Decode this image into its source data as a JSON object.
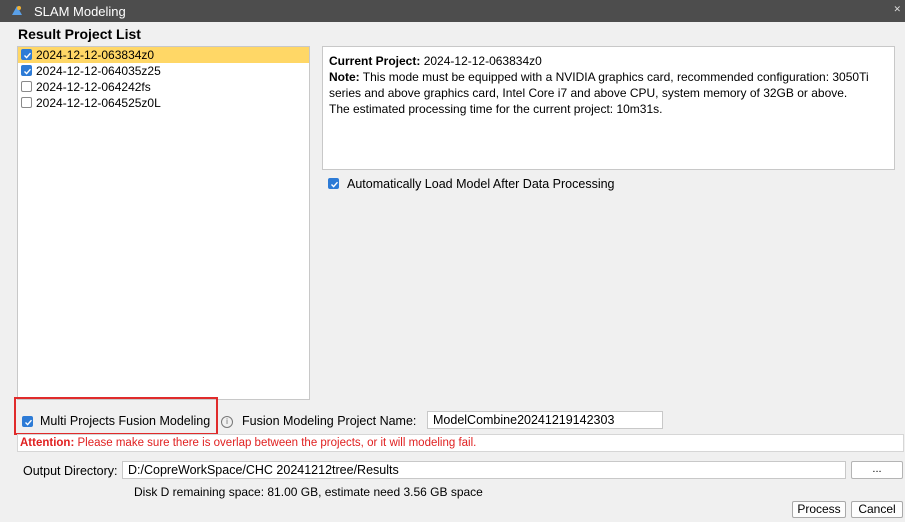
{
  "window": {
    "title": "SLAM Modeling"
  },
  "projects": {
    "heading": "Result Project List",
    "items": [
      {
        "label": "2024-12-12-063834z0",
        "checked": true,
        "selected": true
      },
      {
        "label": "2024-12-12-064035z25",
        "checked": true,
        "selected": false
      },
      {
        "label": "2024-12-12-064242fs",
        "checked": false,
        "selected": false
      },
      {
        "label": "2024-12-12-064525z0L",
        "checked": false,
        "selected": false
      }
    ]
  },
  "info": {
    "current_label": "Current Project:",
    "current_value": "2024-12-12-063834z0",
    "note_label": "Note:",
    "note_text": "This mode must be equipped with a NVIDIA graphics card, recommended configuration: 3050Ti series and above graphics card, Intel Core i7 and above CPU, system memory of 32GB or above.",
    "estimate_text": "The estimated processing time for the current project: 10m31s."
  },
  "auto_load": {
    "label": "Automatically Load Model After Data Processing",
    "checked": true
  },
  "fusion": {
    "label": "Multi Projects Fusion Modeling",
    "checked": true,
    "name_label": "Fusion Modeling Project Name:",
    "name_value": "ModelCombine20241219142303"
  },
  "attention": {
    "label": "Attention:",
    "text": "Please make sure there is overlap between the projects, or it will modeling fail."
  },
  "output": {
    "label": "Output Directory:",
    "path": "D:/CopreWorkSpace/CHC 20241212tree/Results",
    "browse_label": "...",
    "disk_info": "Disk D remaining space: 81.00 GB, estimate need 3.56 GB space"
  },
  "buttons": {
    "process": "Process",
    "cancel": "Cancel"
  },
  "colors": {
    "accent": "#2d7bd6",
    "selection": "#ffd766",
    "warning": "#e02020",
    "titlebar": "#4d4d4d"
  }
}
